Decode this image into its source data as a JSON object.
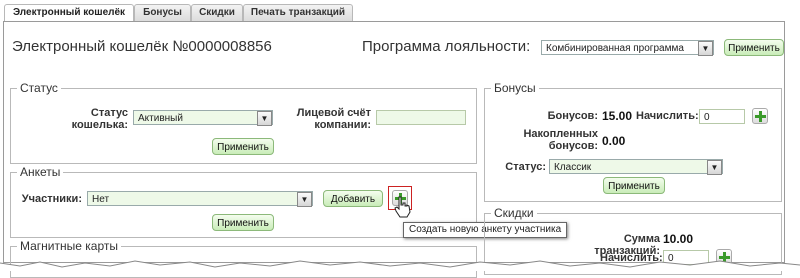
{
  "tabs": [
    "Электронный кошелёк",
    "Бонусы",
    "Скидки",
    "Печать транзакций"
  ],
  "header": {
    "title": "Электронный кошелёк  №0000008856",
    "loyalty_label": "Программа лояльности:",
    "loyalty_value": "Комбинированная программа",
    "apply": "Применить"
  },
  "status": {
    "legend": "Статус",
    "wallet_status_label": "Статус кошелька:",
    "wallet_status_value": "Активный",
    "company_account_label": "Лицевой счёт компании:",
    "company_account_value": "",
    "apply": "Применить"
  },
  "surveys": {
    "legend": "Анкеты",
    "participants_label": "Участники:",
    "participants_value": "Нет",
    "add": "Добавить",
    "apply": "Применить",
    "tooltip": "Создать новую анкету участника"
  },
  "magnetic": {
    "legend": "Магнитные карты"
  },
  "bonuses": {
    "legend": "Бонусы",
    "bonuses_label": "Бонусов:",
    "bonuses_value": "15.00",
    "accrue_label": "Начислить:",
    "accrue_value": "0",
    "accumulated_label": "Накопленных бонусов:",
    "accumulated_value": "0.00",
    "status_label": "Статус:",
    "status_value": "Классик",
    "apply": "Применить"
  },
  "discounts": {
    "legend": "Скидки",
    "sum_label": "Сумма транзакций:",
    "sum_value": "10.00",
    "accrue_label": "Начислить:",
    "accrue_value": "0"
  },
  "colors": {
    "button_green": "#c9ecb8",
    "tooltip_border": "#cc2222"
  }
}
